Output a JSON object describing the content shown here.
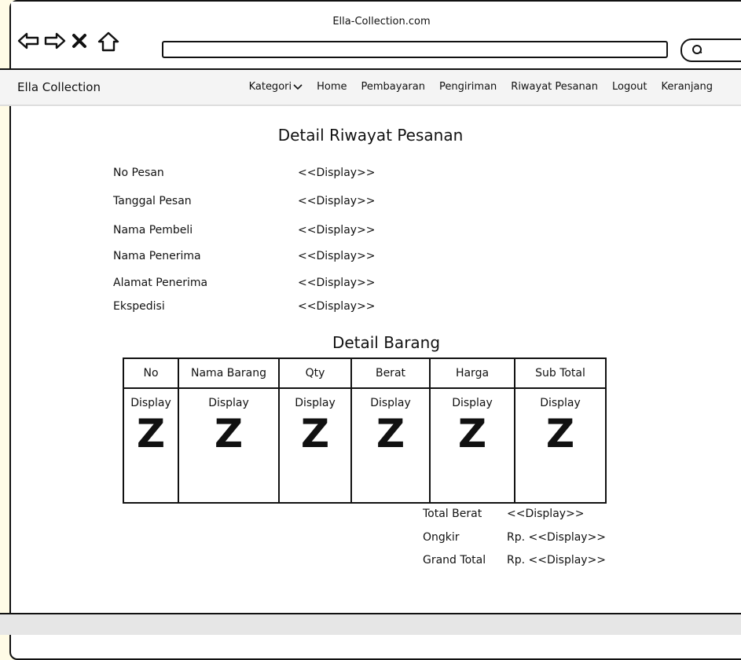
{
  "window": {
    "title": "Ella-Collection.com"
  },
  "menubar": {
    "brand": "Ella Collection",
    "items": [
      "Kategori",
      "Home",
      "Pembayaran",
      "Pengiriman",
      "Riwayat Pesanan",
      "Logout",
      "Keranjang"
    ]
  },
  "page": {
    "title": "Detail Riwayat Pesanan",
    "fields": [
      {
        "label": "No Pesan",
        "value": "<<Display>>"
      },
      {
        "label": "Tanggal Pesan",
        "value": "<<Display>>"
      },
      {
        "label": "Nama Pembeli",
        "value": "<<Display>>"
      },
      {
        "label": "Nama Penerima",
        "value": "<<Display>>"
      },
      {
        "label": "Alamat Penerima",
        "value": "<<Display>>"
      },
      {
        "label": "Ekspedisi",
        "value": "<<Display>>"
      }
    ]
  },
  "items_section": {
    "title": "Detail Barang",
    "columns": [
      "No",
      "Nama Barang",
      "Qty",
      "Berat",
      "Harga",
      "Sub Total"
    ],
    "cell_text": "Display",
    "cell_glyph": "Z"
  },
  "totals": [
    {
      "label": "Total Berat",
      "value": "<<Display>>"
    },
    {
      "label": "Ongkir",
      "value": "Rp. <<Display>>"
    },
    {
      "label": "Grand Total",
      "value": "Rp. <<Display>>"
    }
  ],
  "icons": {
    "back": "arrow-left-icon",
    "forward": "arrow-right-icon",
    "close": "close-icon",
    "home": "home-icon",
    "search": "search-icon",
    "dropdown": "chevron-down-icon"
  }
}
